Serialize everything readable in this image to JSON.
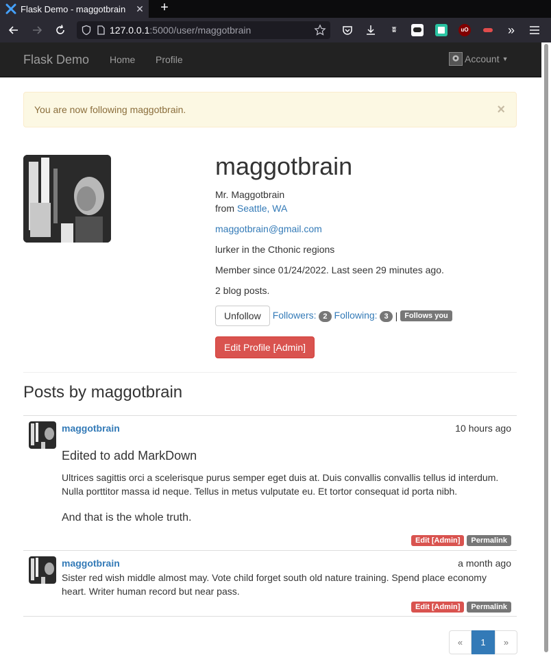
{
  "browser": {
    "tab_title": "Flask Demo - maggotbrain",
    "tab_close": "✕",
    "new_tab": "+",
    "url_host": "127.0.0.1",
    "url_path": ":5000/user/maggotbrain"
  },
  "navbar": {
    "brand": "Flask Demo",
    "links": [
      "Home",
      "Profile"
    ],
    "account_label": "Account"
  },
  "alert": {
    "message": "You are now following maggotbrain.",
    "close": "×"
  },
  "profile": {
    "username": "maggotbrain",
    "full_name": "Mr. Maggotbrain",
    "from_prefix": "from ",
    "location": "Seattle, WA",
    "email": "maggotbrain@gmail.com",
    "about": "lurker in the Cthonic regions",
    "member_since": "Member since 01/24/2022. Last seen 29 minutes ago.",
    "post_count": "2 blog posts.",
    "unfollow_label": "Unfollow",
    "followers_label": "Followers:",
    "followers_count": "2",
    "following_label": "Following:",
    "following_count": "3",
    "separator": "|",
    "follows_you": "Follows you",
    "edit_profile_label": "Edit Profile [Admin]"
  },
  "posts_heading": "Posts by maggotbrain",
  "posts": [
    {
      "author": "maggotbrain",
      "date": "10 hours ago",
      "heading": "Edited to add MarkDown",
      "paragraph": "Ultrices sagittis orci a scelerisque purus semper eget duis at. Duis convallis convallis tellus id interdum. Nulla porttitor massa id neque. Tellus in metus vulputate eu. Et tortor consequat id porta nibh.",
      "closing": "And that is the whole truth.",
      "edit_label": "Edit [Admin]",
      "permalink_label": "Permalink"
    },
    {
      "author": "maggotbrain",
      "date": "a month ago",
      "paragraph": "Sister red wish middle almost may. Vote child forget south old nature training. Spend place economy heart. Writer human record but near pass.",
      "edit_label": "Edit [Admin]",
      "permalink_label": "Permalink"
    }
  ],
  "pagination": {
    "prev": "«",
    "current": "1",
    "next": "»"
  },
  "colors": {
    "link": "#337ab7",
    "danger": "#d9534f",
    "navbar": "#222222",
    "alert_bg": "#fcf8e3"
  }
}
